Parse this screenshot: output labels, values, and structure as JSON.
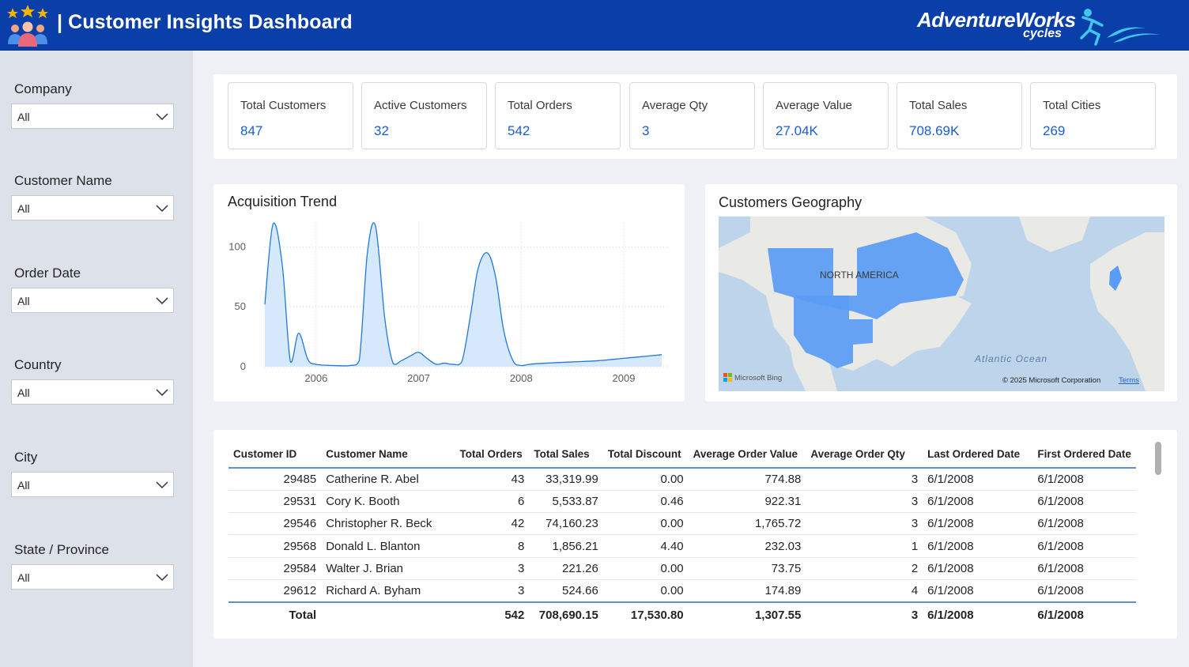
{
  "header": {
    "title": "| Customer Insights Dashboard",
    "brand_name": "AdventureWorks",
    "brand_sub": "cycles",
    "icon": "customers-icon",
    "color": "#0a3ea8"
  },
  "slicers": [
    {
      "label": "Company",
      "value": "All"
    },
    {
      "label": "Customer Name",
      "value": "All"
    },
    {
      "label": "Order Date",
      "value": "All"
    },
    {
      "label": "Country",
      "value": "All"
    },
    {
      "label": "City",
      "value": "All"
    },
    {
      "label": "State / Province",
      "value": "All"
    }
  ],
  "kpis": [
    {
      "label": "Total Customers",
      "value": "847"
    },
    {
      "label": "Active Customers",
      "value": "32"
    },
    {
      "label": "Total Orders",
      "value": "542"
    },
    {
      "label": "Average Qty",
      "value": "3"
    },
    {
      "label": "Average Value",
      "value": "27.04K"
    },
    {
      "label": "Total Sales",
      "value": "708.69K"
    },
    {
      "label": "Total Cities",
      "value": "269"
    }
  ],
  "acquisition": {
    "title": "Acquisition Trend",
    "color": "#1f7ad9",
    "fill": "#d6e8fb"
  },
  "chart_data": {
    "type": "area",
    "title": "Acquisition Trend",
    "xlabel": "",
    "ylabel": "",
    "x_ticks": [
      "2006",
      "2007",
      "2008",
      "2009"
    ],
    "y_ticks": [
      0,
      50,
      100
    ],
    "ylim": [
      0,
      120
    ],
    "grid": true,
    "series": [
      {
        "x": [
          2005.5,
          2005.58,
          2005.67,
          2005.75,
          2005.83,
          2005.92,
          2006.0,
          2006.17,
          2006.33,
          2006.42,
          2006.5,
          2006.58,
          2006.67,
          2006.75,
          2006.83,
          2006.92,
          2007.0,
          2007.08,
          2007.17,
          2007.25,
          2007.33,
          2007.42,
          2007.5,
          2007.58,
          2007.67,
          2007.75,
          2007.83,
          2007.92,
          2008.0,
          2008.08,
          2008.25,
          2008.5,
          2008.75,
          2009.0,
          2009.25,
          2009.37
        ],
        "values": [
          52,
          119,
          85,
          4,
          28,
          6,
          2,
          1,
          1,
          5,
          95,
          117,
          40,
          3,
          5,
          9,
          12,
          7,
          2,
          3,
          2,
          4,
          40,
          82,
          95,
          75,
          30,
          5,
          1,
          2,
          3,
          4,
          5,
          7,
          9,
          10
        ]
      }
    ]
  },
  "geography": {
    "title": "Customers Geography",
    "map_label": "NORTH AMERICA",
    "ocean_label": "Atlantic Ocean",
    "bing_label": "Microsoft Bing",
    "copyright": "© 2025 Microsoft Corporation",
    "terms": "Terms",
    "highlight_color": "#5a9bf5"
  },
  "table": {
    "columns": [
      "Customer ID",
      "Customer Name",
      "Total Orders",
      "Total Sales",
      "Total Discount",
      "Average Order Value",
      "Average Order Qty",
      "Last Ordered Date",
      "First Ordered Date"
    ],
    "rows": [
      [
        "29485",
        "Catherine R. Abel",
        "43",
        "33,319.99",
        "0.00",
        "774.88",
        "3",
        "6/1/2008",
        "6/1/2008"
      ],
      [
        "29531",
        "Cory K. Booth",
        "6",
        "5,533.87",
        "0.46",
        "922.31",
        "3",
        "6/1/2008",
        "6/1/2008"
      ],
      [
        "29546",
        "Christopher R. Beck",
        "42",
        "74,160.23",
        "0.00",
        "1,765.72",
        "3",
        "6/1/2008",
        "6/1/2008"
      ],
      [
        "29568",
        "Donald L. Blanton",
        "8",
        "1,856.21",
        "4.40",
        "232.03",
        "1",
        "6/1/2008",
        "6/1/2008"
      ],
      [
        "29584",
        "Walter J. Brian",
        "3",
        "221.26",
        "0.00",
        "73.75",
        "2",
        "6/1/2008",
        "6/1/2008"
      ],
      [
        "29612",
        "Richard A. Byham",
        "3",
        "524.66",
        "0.00",
        "174.89",
        "4",
        "6/1/2008",
        "6/1/2008"
      ]
    ],
    "total": [
      "Total",
      "",
      "542",
      "708,690.15",
      "17,530.80",
      "1,307.55",
      "3",
      "6/1/2008",
      "6/1/2008"
    ]
  }
}
